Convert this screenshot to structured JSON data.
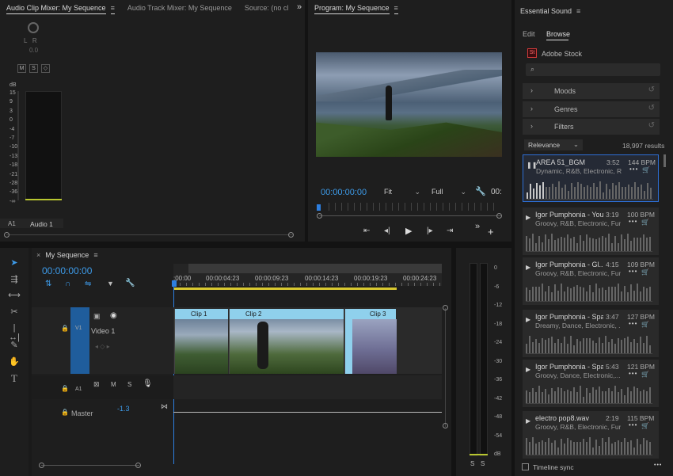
{
  "clip_mixer": {
    "tabs": [
      "Audio Clip Mixer: My Sequence",
      "Audio Track Mixer: My Sequence",
      "Source: (no cl"
    ],
    "menu_glyph": "≡",
    "overflow": "»",
    "lr": "L   R",
    "value": "0.0",
    "m": "M",
    "s": "S",
    "db_label": "dB",
    "db_scale": [
      "15",
      "9",
      "3",
      "0",
      "-4",
      "-7",
      "-10",
      "-13",
      "-18",
      "-21",
      "-28",
      "-36",
      "-∞"
    ],
    "track_a1": "A1",
    "track_name": "Audio 1"
  },
  "program": {
    "title": "Program: My Sequence",
    "menu_glyph": "≡",
    "timecode": "00:00:00:00",
    "fit": "Fit",
    "full": "Full",
    "timecode_right": "00:",
    "overflow": "»",
    "add": "+"
  },
  "timeline": {
    "tab": "My Sequence",
    "menu_glyph": "≡",
    "close": "×",
    "timecode": "00:00:00:00",
    "ruler": [
      ":00:00",
      "00:00:04:23",
      "00:00:09:23",
      "00:00:14:23",
      "00:00:19:23",
      "00:00:24:23"
    ],
    "clips": [
      "Clip 1",
      "Clip 2",
      "Clip 3"
    ],
    "v1": "V1",
    "video1": "Video 1",
    "a1": "A1",
    "m": "M",
    "s": "S",
    "master": "Master",
    "master_value": "-1.3",
    "meter_scale": [
      "0",
      "-6",
      "-12",
      "-18",
      "-24",
      "-30",
      "-36",
      "-42",
      "-48",
      "-54",
      "dB"
    ],
    "solo": [
      "S",
      "S"
    ]
  },
  "essential_sound": {
    "title": "Essential Sound",
    "menu_glyph": "≡",
    "tabs": [
      "Edit",
      "Browse"
    ],
    "stock_badge": "St",
    "stock_label": "Adobe Stock",
    "filters": [
      "Moods",
      "Genres",
      "Filters"
    ],
    "sort": "Relevance",
    "results": "18,997 results",
    "timeline_sync": "Timeline sync",
    "more": "•••",
    "tracks": [
      {
        "title": "AREA 51_BGM",
        "duration": "3:52",
        "bpm": "144 BPM",
        "tags": "Dynamic, R&B, Electronic, R..."
      },
      {
        "title": "Igor Pumphonia - Your...",
        "duration": "3:19",
        "bpm": "100 BPM",
        "tags": "Groovy, R&B, Electronic, Funk"
      },
      {
        "title": "Igor Pumphonia - Gl...",
        "duration": "4:15",
        "bpm": "109 BPM",
        "tags": "Groovy, R&B, Electronic, Funk"
      },
      {
        "title": "Igor Pumphonia - Spa...",
        "duration": "3:47",
        "bpm": "127 BPM",
        "tags": "Dreamy, Dance, Electronic, ..."
      },
      {
        "title": "Igor Pumphonia - Spa...",
        "duration": "5:43",
        "bpm": "121 BPM",
        "tags": "Groovy, Dance, Electronic,..."
      },
      {
        "title": "electro pop8.wav",
        "duration": "2:19",
        "bpm": "115 BPM",
        "tags": "Groovy, R&B, Electronic, Funk"
      }
    ]
  },
  "colors": {
    "accent": "#2d8ceb",
    "playhead": "#2d7fe0",
    "clip_tab": "#8fd0ec",
    "work_area": "#d8c830"
  }
}
